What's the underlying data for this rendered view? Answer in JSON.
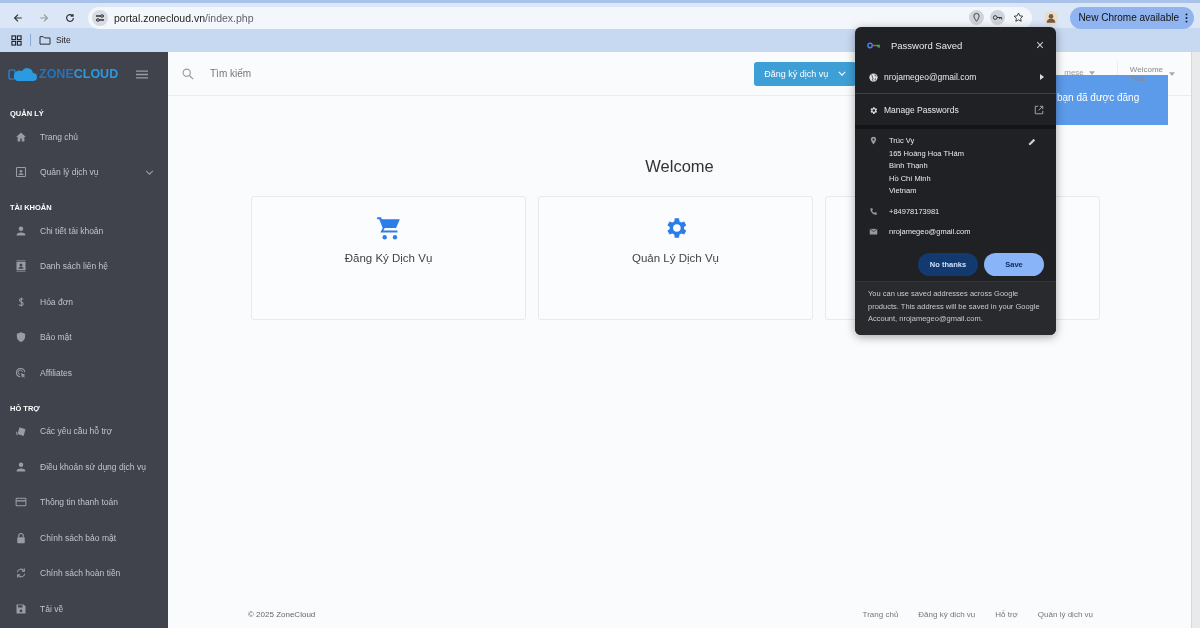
{
  "browser": {
    "url": {
      "host": "portal.zonecloud.vn",
      "path": "/index.php"
    },
    "update_button": "New Chrome available",
    "bookmarks": [
      {
        "label": "Site"
      }
    ]
  },
  "sidebar": {
    "logo": {
      "part1": "ZONE",
      "part2": "CLOUD"
    },
    "sections": [
      {
        "title": "QUẢN LÝ",
        "items": [
          {
            "label": "Trang chủ",
            "has_submenu": false
          },
          {
            "label": "Quản lý dịch vụ",
            "has_submenu": true
          }
        ]
      },
      {
        "title": "TÀI KHOẢN",
        "items": [
          {
            "label": "Chi tiết tài khoản",
            "has_submenu": false
          },
          {
            "label": "Danh sách liên hệ",
            "has_submenu": false
          },
          {
            "label": "Hóa đơn",
            "has_submenu": false
          },
          {
            "label": "Bảo mật",
            "has_submenu": false
          },
          {
            "label": "Affiliates",
            "has_submenu": false
          }
        ]
      },
      {
        "title": "HỖ TRỢ",
        "items": [
          {
            "label": "Các yêu cầu hỗ trợ",
            "has_submenu": false
          },
          {
            "label": "Điều khoản sử dụng dịch vụ",
            "has_submenu": false
          },
          {
            "label": "Thông tin thanh toán",
            "has_submenu": false
          },
          {
            "label": "Chính sách bảo mật",
            "has_submenu": false
          },
          {
            "label": "Chính sách hoàn tiền",
            "has_submenu": false
          },
          {
            "label": "Tải về",
            "has_submenu": false
          }
        ]
      }
    ]
  },
  "header": {
    "search": {
      "placeholder": "Tìm kiếm"
    },
    "register_button": "Đăng ký dịch vụ",
    "language": "mese",
    "user": [
      "Welcome",
      "Trúc"
    ]
  },
  "toast": "bạn đã được đăng",
  "main": {
    "title": "Welcome",
    "cards": [
      {
        "kind": "service",
        "label": "Đăng Ký Dịch Vụ"
      },
      {
        "kind": "service",
        "label": "Quản Lý Dịch Vụ"
      },
      {
        "kind": "covered"
      }
    ]
  },
  "footer": {
    "copyright": "© 2025 ZoneCloud",
    "links": [
      "Trang chủ",
      "Đăng ký dịch vụ",
      "Hỗ trợ",
      "Quản lý dịch vụ"
    ]
  },
  "popup": {
    "title": "Password Saved",
    "account": "nrojamegeo@gmail.com",
    "manage": "Manage Passwords",
    "address": [
      "Trúc Vy",
      "165 Hoàng Hoa THám",
      "Bình Thạnh",
      "Hồ Chí Minh",
      "Vietnam"
    ],
    "phone": "+84978173981",
    "email": "nrojamegeo@gmail.com",
    "buttons": [
      {
        "kind": "secondary",
        "label": "No thanks"
      },
      {
        "kind": "primary",
        "label": "Save"
      }
    ],
    "note": "You can use saved addresses across Google products. This address will be saved in your Google Account, nrojamegeo@gmail.com."
  }
}
